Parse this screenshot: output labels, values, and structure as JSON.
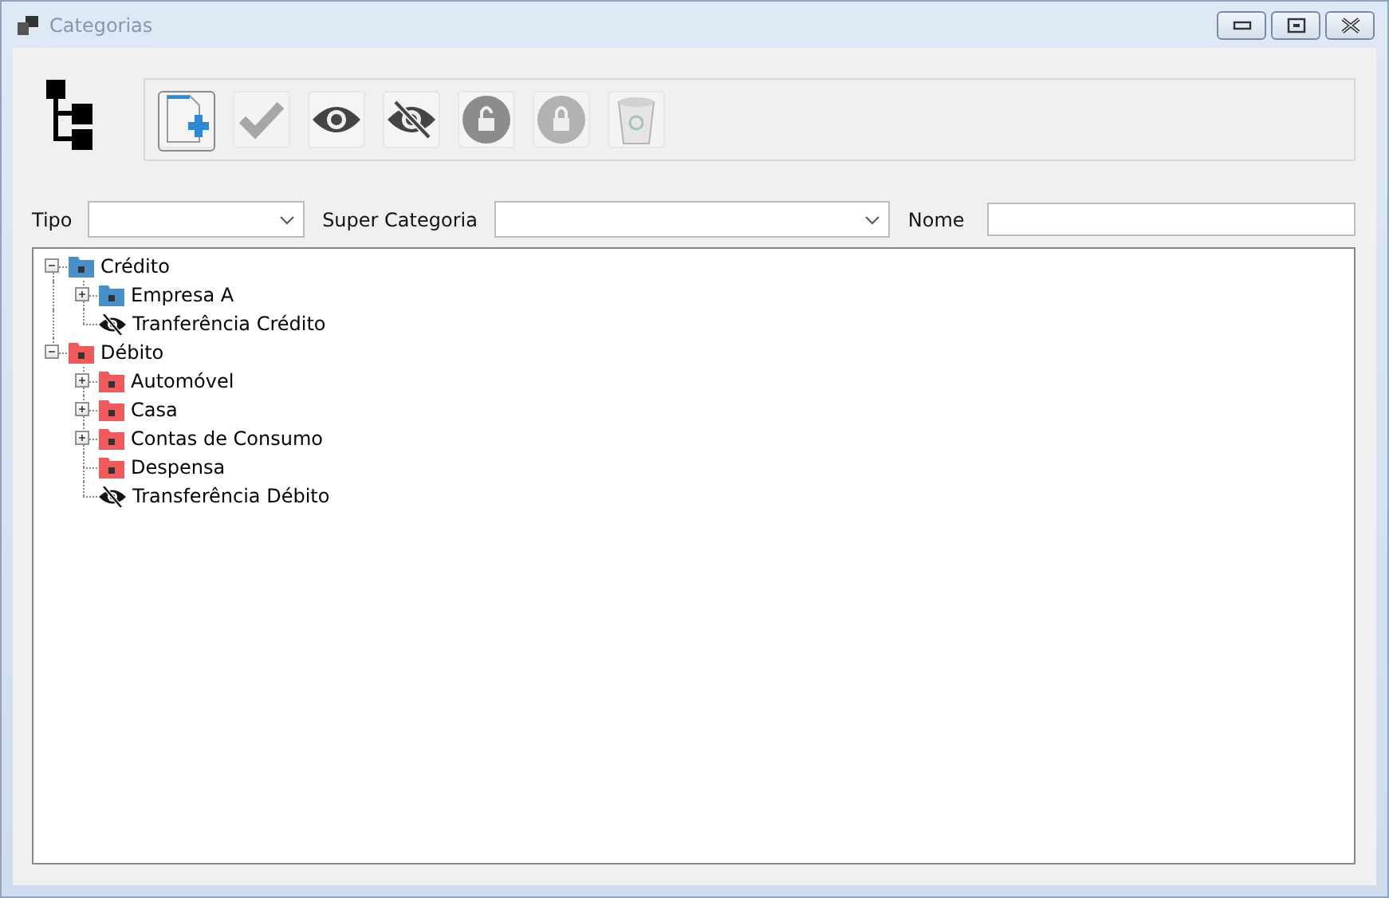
{
  "window": {
    "title": "Categorias"
  },
  "toolbar": [
    {
      "kind": "new",
      "disabled": false,
      "focused": true
    },
    {
      "kind": "check",
      "disabled": true
    },
    {
      "kind": "show",
      "disabled": false
    },
    {
      "kind": "hide",
      "disabled": false
    },
    {
      "kind": "unlock",
      "disabled": false
    },
    {
      "kind": "lock",
      "disabled": true
    },
    {
      "kind": "trash",
      "disabled": true
    }
  ],
  "filters": {
    "tipo_label": "Tipo",
    "super_label": "Super Categoria",
    "nome_label": "Nome"
  },
  "tree": [
    {
      "label": "Crédito",
      "kind": "folder",
      "color": "#4a90c8",
      "expanded": true,
      "children": [
        {
          "label": "Empresa A",
          "kind": "folder",
          "color": "#4a90c8",
          "expanded": false
        },
        {
          "label": "Tranferência Crédito",
          "kind": "hidden"
        }
      ]
    },
    {
      "label": "Débito",
      "kind": "folder",
      "color": "#f05a5a",
      "expanded": true,
      "children": [
        {
          "label": "Automóvel",
          "kind": "folder",
          "color": "#f05a5a",
          "expanded": false
        },
        {
          "label": "Casa",
          "kind": "folder",
          "color": "#f05a5a",
          "expanded": false
        },
        {
          "label": "Contas de Consumo",
          "kind": "folder",
          "color": "#f05a5a",
          "expanded": false
        },
        {
          "label": "Despensa",
          "kind": "folder",
          "color": "#f05a5a"
        },
        {
          "label": "Transferência Débito",
          "kind": "hidden"
        }
      ]
    }
  ]
}
